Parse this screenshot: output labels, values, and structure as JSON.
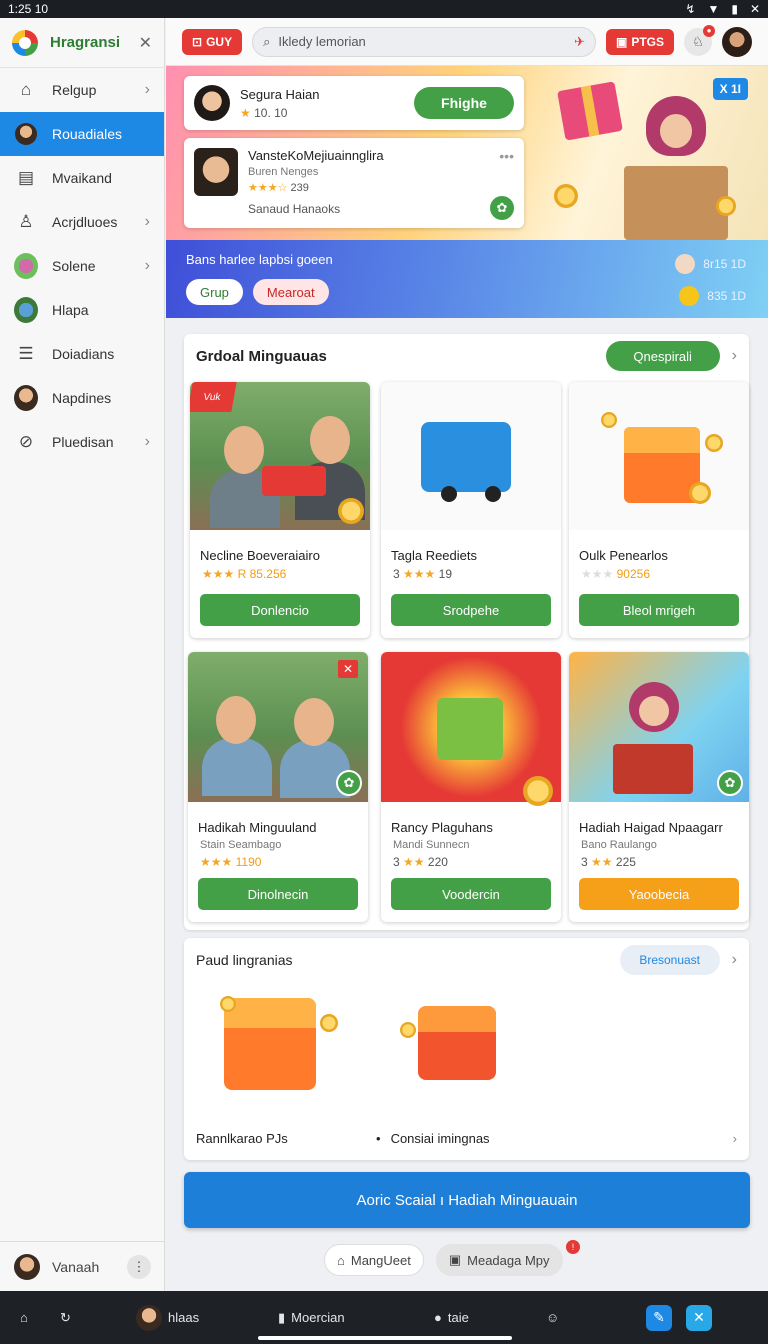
{
  "status": {
    "time": "1:25",
    "extra": "10"
  },
  "sidebar": {
    "brand": "Hragransi",
    "items": [
      {
        "label": "Relgup",
        "icon": "home-icon",
        "chev": true
      },
      {
        "label": "Rouadiales",
        "icon": "avatar",
        "chev": false,
        "active": true
      },
      {
        "label": "Mvaikand",
        "icon": "store-icon",
        "chev": false
      },
      {
        "label": "Acrjdluoes",
        "icon": "user-icon",
        "chev": true
      },
      {
        "label": "Solene",
        "icon": "avatar",
        "chev": true
      },
      {
        "label": "Hlapa",
        "icon": "avatar",
        "chev": false
      },
      {
        "label": "Doiadians",
        "icon": "list-icon",
        "chev": false
      },
      {
        "label": "Napdines",
        "icon": "avatar",
        "chev": false
      },
      {
        "label": "Pluedisan",
        "icon": "compass-icon",
        "chev": true
      }
    ],
    "footer": {
      "label": "Vanaah"
    }
  },
  "topbar": {
    "chip": "GUY",
    "search_placeholder": "Ikledy lemorian",
    "chip2": "PTGS"
  },
  "hero": {
    "close": "X 1I",
    "card1": {
      "name": "Segura Haian",
      "rating": "10. 10",
      "button": "Fhighe"
    },
    "card2": {
      "name": "VansteKoMejiuainnglira",
      "sub": "Buren Nenges",
      "rating": "239",
      "footer": "Sanaud Hanaoks"
    }
  },
  "banner": {
    "text": "Bans harlee lapbsi goeen",
    "pill1": "Grup",
    "pill2": "Mearoat",
    "stat1": "8r15 1D",
    "stat2": "835 1D"
  },
  "panel": {
    "title": "Grdoal Minguauas",
    "button": "Qnespirali",
    "products": [
      {
        "name": "Necline Boeveraiairo",
        "sub": "",
        "rating": "R 85.256",
        "button": "Donlencio",
        "style": "photo",
        "ribbon": "Vuk"
      },
      {
        "name": "Tagla Reediets",
        "sub": "",
        "rating": "19",
        "prefix": "3",
        "button": "Srodpehe",
        "style": "blue"
      },
      {
        "name": "Oulk Penearlos",
        "sub": "",
        "rating": "90256",
        "button": "Bleol mrigeh",
        "style": "gift"
      },
      {
        "name": "Hadikah Minguuland",
        "sub": "Stain Seambago",
        "rating": "1190",
        "button": "Dinolnecin",
        "style": "photo2"
      },
      {
        "name": "Rancy Plaguhans",
        "sub": "Mandi Sunnecn",
        "rating": "220",
        "prefix": "3",
        "button": "Voodercin",
        "style": "red"
      },
      {
        "name": "Hadiah Haigad Npaagarr",
        "sub": "Bano Raulango",
        "rating": "225",
        "prefix": "3",
        "button": "Yaoobecia",
        "style": "sun"
      }
    ]
  },
  "panel2": {
    "title": "Paud lingranias",
    "button": "Bresonuast",
    "foot_left": "Rannlkarao PJs",
    "foot_right": "Consiai imingnas"
  },
  "cta": "Aoric Scaial ı Hadiah Minguauain",
  "sub_buttons": {
    "left": "MangUeet",
    "right": "Meadaga Mpy"
  },
  "bottom": {
    "item1": "hlaas",
    "item2": "Moercian",
    "item3": "taie"
  },
  "colors": {
    "accent": "#1e88e5",
    "green": "#43a047",
    "red": "#e53935"
  }
}
